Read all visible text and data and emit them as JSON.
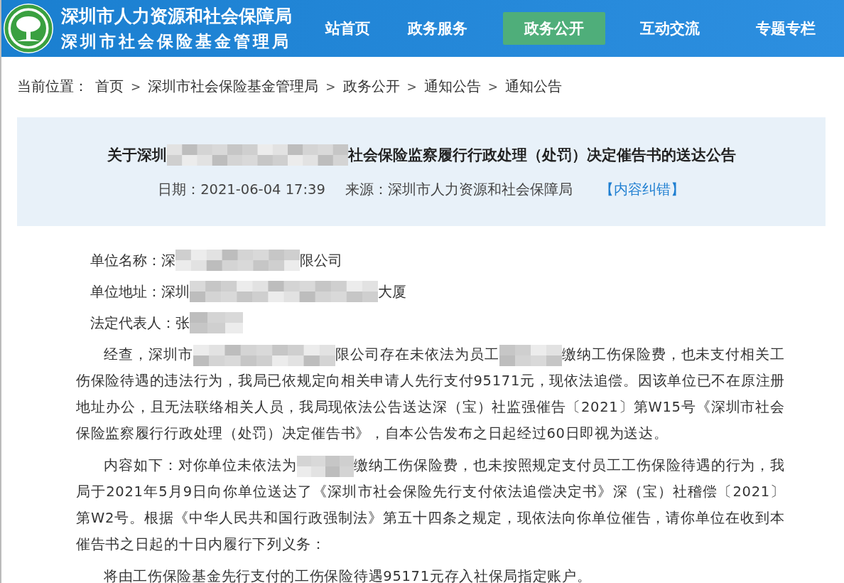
{
  "header": {
    "title": "深圳市人力资源和社会保障局",
    "subtitle": "深圳市社会保险基金管理局",
    "nav": [
      {
        "label": "站首页",
        "selected": false
      },
      {
        "label": "政务服务",
        "selected": false
      },
      {
        "label": "政务公开",
        "selected": true
      },
      {
        "label": "互动交流",
        "selected": false
      },
      {
        "label": "专题专栏",
        "selected": false
      }
    ]
  },
  "breadcrumb": {
    "label": "当前位置：",
    "items": [
      "首页",
      "深圳市社会保险基金管理局",
      "政务公开",
      "通知公告",
      "通知公告"
    ],
    "separator": ">"
  },
  "notice": {
    "title": [
      {
        "kind": "text",
        "text": "关于深圳"
      },
      {
        "kind": "redacted"
      },
      {
        "kind": "text",
        "text": "社会保险监察履行行政处理（处罚）决定催告书的送达公告"
      }
    ],
    "date": "日期：2021-06-04 17:39",
    "source": "来源：深圳市人力资源和社会保障局",
    "correction_link": "【内容纠错】"
  },
  "fields": [
    [
      {
        "kind": "text",
        "text": "单位名称：深"
      },
      {
        "kind": "redacted"
      },
      {
        "kind": "text",
        "text": "限公司"
      }
    ],
    [
      {
        "kind": "text",
        "text": "单位地址：深圳"
      },
      {
        "kind": "redacted"
      },
      {
        "kind": "text",
        "text": "大厦"
      }
    ],
    [
      {
        "kind": "text",
        "text": "法定代表人：张"
      },
      {
        "kind": "redacted"
      }
    ]
  ],
  "paragraphs": [
    [
      {
        "kind": "text",
        "text": "经查，深圳市"
      },
      {
        "kind": "redacted"
      },
      {
        "kind": "text",
        "text": "限公司存在未依法为员工"
      },
      {
        "kind": "redacted"
      },
      {
        "kind": "text",
        "text": "缴纳工伤保险费，也未支付相关工伤保险待遇的违法行为，我局已依规定向相关申请人先行支付95171元，现依法追偿。因该单位已不在原注册地址办公，且无法联络相关人员，我局现依法公告送达深（宝）社监强催告〔2021〕第W15号《深圳市社会保险监察履行行政处理（处罚）决定催告书》，自本公告发布之日起经过60日即视为送达。"
      }
    ],
    [
      {
        "kind": "text",
        "text": "内容如下：对你单位未依法为"
      },
      {
        "kind": "redacted"
      },
      {
        "kind": "text",
        "text": "缴纳工伤保险费，也未按照规定支付员工工伤保险待遇的行为，我局于2021年5月9日向你单位送达了《深圳市社会保险先行支付依法追偿决定书》深（宝）社稽偿〔2021〕第W2号。根据《中华人民共和国行政强制法》第五十四条之规定，现依法向你单位催告，请你单位在收到本催告书之日起的十日内履行下列义务："
      }
    ],
    [
      {
        "kind": "text",
        "text": "将由工伤保险基金先行支付的工伤保险待遇95171元存入社保局指定账户。"
      }
    ]
  ]
}
